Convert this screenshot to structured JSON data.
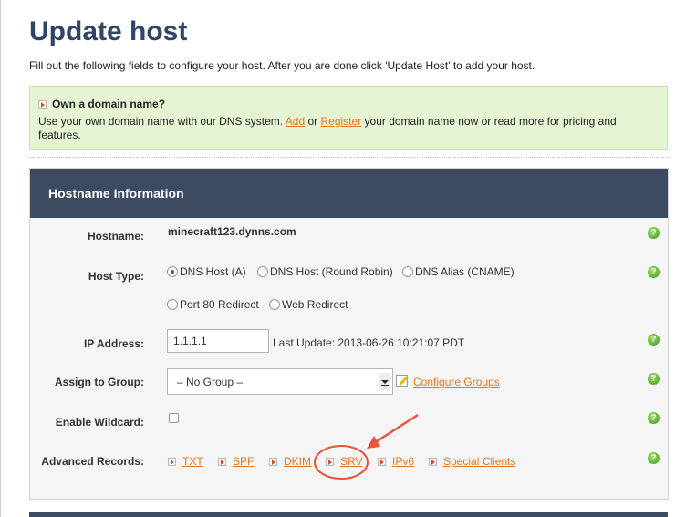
{
  "page": {
    "title": "Update host",
    "intro": "Fill out the following fields to configure your host. After you are done click 'Update Host' to add your host."
  },
  "promo": {
    "title": "Own a domain name?",
    "text_before": "Use your own domain name with our DNS system.",
    "add_link": "Add",
    "or": "or",
    "register_link": "Register",
    "text_after": "your domain name now or read more for pricing and features."
  },
  "panel": {
    "header": "Hostname Information",
    "hostname_label": "Hostname:",
    "hostname_value": "minecraft123.dynns.com",
    "host_type_label": "Host Type:",
    "host_types": [
      {
        "label": "DNS Host (A)",
        "selected": true
      },
      {
        "label": "DNS Host (Round Robin)",
        "selected": false
      },
      {
        "label": "DNS Alias (CNAME)",
        "selected": false
      },
      {
        "label": "Port 80 Redirect",
        "selected": false
      },
      {
        "label": "Web Redirect",
        "selected": false
      }
    ],
    "ip_label": "IP Address:",
    "ip_value": "1.1.1.1",
    "last_update": "Last Update: 2013-06-26 10:21:07 PDT",
    "group_label": "Assign to Group:",
    "group_value": "– No Group –",
    "configure_groups": "Configure Groups",
    "wildcard_label": "Enable Wildcard:",
    "wildcard_checked": false,
    "advanced_label": "Advanced Records:",
    "advanced_records": [
      "TXT",
      "SPF",
      "DKIM",
      "SRV",
      "IPv6",
      "Special Clients"
    ],
    "help_glyph": "?"
  },
  "icons": {
    "help": "help-icon",
    "arrow": "arrow-bullet-icon",
    "edit": "edit-pencil-icon"
  },
  "colors": {
    "title": "#2f4566",
    "header_bg": "#3c4a62",
    "link": "#e8761c",
    "promo_bg": "#e6f4d4",
    "annotation": "#e8533a"
  }
}
